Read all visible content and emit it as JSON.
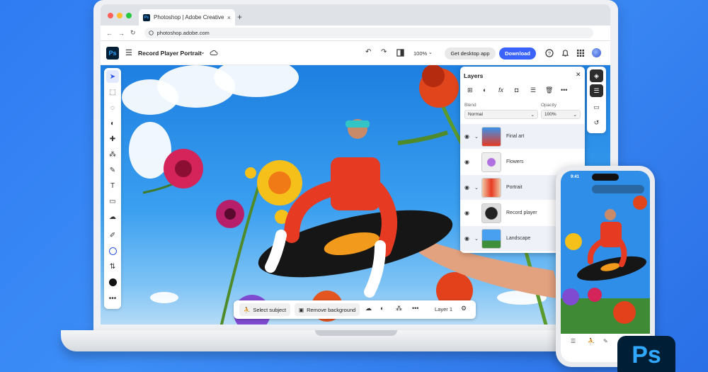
{
  "browser": {
    "tab_title": "Photoshop | Adobe Creative C",
    "tab_close": "×",
    "new_tab": "+",
    "url": "photoshop.adobe.com",
    "back": "←",
    "forward": "→",
    "reload": "↻"
  },
  "app": {
    "logo": "Ps",
    "document_title": "Record Player Portrait",
    "zoom": "100%",
    "get_desktop_label": "Get desktop app",
    "download_label": "Download"
  },
  "layers_panel": {
    "title": "Layers",
    "blend_label": "Blend",
    "blend_value": "Normal",
    "opacity_label": "Opacity",
    "opacity_value": "100%",
    "layers": [
      {
        "name": "Final art"
      },
      {
        "name": "Flowers"
      },
      {
        "name": "Portrait"
      },
      {
        "name": "Record player"
      },
      {
        "name": "Landscape"
      }
    ]
  },
  "context_bar": {
    "select_subject": "Select subject",
    "remove_background": "Remove background",
    "more": "•••",
    "layer": "Layer 1"
  },
  "phone": {
    "time": "9:41"
  },
  "badge": "Ps",
  "colors": {
    "background": "#2f7bf2",
    "accent": "#3b63fb",
    "ps_dark": "#001e36",
    "ps_blue": "#31a8ff"
  }
}
